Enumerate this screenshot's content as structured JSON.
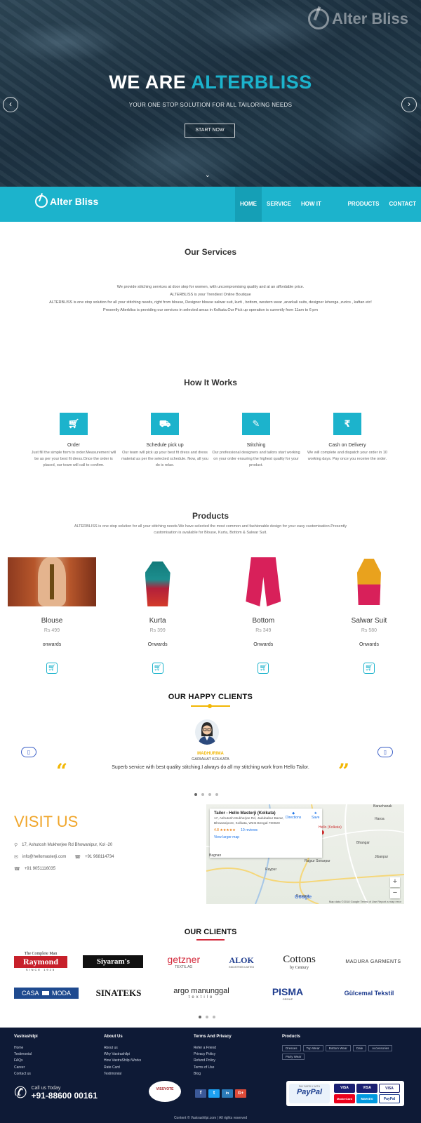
{
  "brand": {
    "name": "Alter Bliss"
  },
  "hero": {
    "title_prefix": "WE ARE",
    "title_accent": "ALTERBLISS",
    "subtitle": "YOUR ONE STOP SOLUTION FOR ALL TAILORING NEEDS",
    "cta": "START NOW"
  },
  "nav": {
    "items": [
      {
        "label": "HOME",
        "active": true
      },
      {
        "label": "SERVICE",
        "active": false
      },
      {
        "label": "HOW IT WORKS",
        "active": false
      },
      {
        "label": "PRODUCTS",
        "active": false
      },
      {
        "label": "CONTACT",
        "active": false
      }
    ]
  },
  "services": {
    "title": "Our Services",
    "lines": [
      "We provide stitching services at door step for women, with uncompromising quality and at an affordable price.",
      "ALTERBLISS is your Trendiest Online Boutique",
      "ALTERBLISS is one stop solution for all your stitching needs, right from blouse, Designer blouse salwar suit, kurti , bottom, western wear ,anarkali suits, designer lehenga ,zurics , kaftan etc!",
      "Presently Alterbliss is providing our services in selected areas in Kolkata.Our Pick up operation is currently from 11am to 6 pm"
    ]
  },
  "how_it_works": {
    "title": "How It Works",
    "steps": [
      {
        "title": "Order",
        "icon": "cart-icon",
        "desc": "Just fill the simple form to order.Measurement will be as per your best fit dress.Once the order is placed, our team will call to confirm."
      },
      {
        "title": "Schedule pick up",
        "icon": "truck-icon",
        "desc": "Our team will pick up your best fit dress and dress material as per the selected schedule. Now, all you do is relax."
      },
      {
        "title": "Stitching",
        "icon": "wrench-icon",
        "desc": "Our professional designers and tailors start working on your order ensuring the highest quality for your product."
      },
      {
        "title": "Cash on Delivery",
        "icon": "rupee-icon",
        "desc": "We will complete and dispatch your order in 10 working days. Pay once you receive the order."
      }
    ]
  },
  "products": {
    "title": "Products",
    "intro": "ALTERBLISS is one stop solution for all your stitching needs.We have selected the most common and fashionable design for your easy customisation.Presently customisation is available for Blouse, Kurta, Bottom & Salwar Suit.",
    "items": [
      {
        "name": "Blouse",
        "price": "Rs 499",
        "onwards": "onwards"
      },
      {
        "name": "Kurta",
        "price": "Rs 399",
        "onwards": "Onwards"
      },
      {
        "name": "Bottom",
        "price": "Rs 349",
        "onwards": "Onwards"
      },
      {
        "name": "Salwar Suit",
        "price": "Rs 580",
        "onwards": "Onwards"
      }
    ]
  },
  "testimonials": {
    "title": "OUR HAPPY CLIENTS",
    "name": "MADHURIMA",
    "location": "GARIAHAT KOLKATA",
    "quote": "Superb service with best quality stitching.I always do all my stitching work from Hello Tailor."
  },
  "visit": {
    "title": "VISIT US",
    "address": "17, Ashutosh Mukherjee Rd Bhowanipur, Kol -20",
    "email": "info@hellomasterji.com",
    "phone1": "+91 968114734",
    "phone2": "+91 9051116035"
  },
  "map": {
    "place_title": "Tailor - Hello Masterji (Kolkata)",
    "place_address": "17, Ashutosh Mukherjee Rd, Jadubabur Bazar, Bhowanipore, Kolkata, West Bengal 700020",
    "rating": "4.8",
    "stars": "★★★★★",
    "reviews": "10 reviews",
    "view_larger": "View larger map",
    "directions": "Directions",
    "save": "Save",
    "places": [
      "Barachanak",
      "Rajpur Sonarpur",
      "Bagnan",
      "Raypur",
      "Baruipur",
      "Bhangar",
      "Jibanpur",
      "Haroa",
      "Hello (Kolkata)"
    ],
    "footer": "Map data ©2018 Google   Terms of Use   Report a map error",
    "google": "Google"
  },
  "clients": {
    "title": "OUR CLIENTS",
    "row1": [
      "The Complete Man",
      "Raymond",
      "SINCE 1925",
      "Siyaram's",
      "getzner",
      "TEXTIL AG",
      "ALOK",
      "INDUSTRIES LIMITED",
      "Cottons",
      "by Century",
      "MADURA GARMENTS"
    ],
    "row2": [
      "CASA",
      "MODA",
      "SINATEKS",
      "argo manunggal",
      "textile",
      "PISMA",
      "GROUP",
      "Gülcemal Tekstil"
    ]
  },
  "footer": {
    "col1": {
      "title": "Vastrashilpi",
      "links": [
        "Home",
        "Testimonial",
        "FAQs",
        "Career",
        "Contact us"
      ]
    },
    "col2": {
      "title": "About Us",
      "links": [
        "About us",
        "Why Vastrashilpi",
        "How VastraShilpi Works",
        "Rate Card",
        "Testimonial"
      ]
    },
    "col3": {
      "title": "Terms And Privacy",
      "links": [
        "Refer a Friend",
        "Privacy Policy",
        "Refund Policy",
        "Terms of Use",
        "Blog"
      ]
    },
    "col4": {
      "title": "Products",
      "tags": [
        "Dresses",
        "Top Wear",
        "Bottom Wear",
        "Dale",
        "Accessories",
        "Party Wear"
      ]
    },
    "call_label": "Call us Today",
    "call_number": "+91-88600 00161",
    "vmark": "VISSYOTE",
    "social": [
      "f",
      "t",
      "in",
      "G+"
    ],
    "pay_safe": "PAY SAFELY WITH",
    "paypal": "PayPal",
    "cards": [
      "VISA",
      "VISA",
      "VISA",
      "MasterCard",
      "Maestro",
      "PayPal"
    ],
    "copyright": "Content © Vastrashilpi.com | All rights reserved"
  },
  "colors": {
    "accent": "#1cb3cc",
    "gold": "#f2b705",
    "footer_bg": "#0e1a36",
    "clients_line": "#d3283a"
  }
}
